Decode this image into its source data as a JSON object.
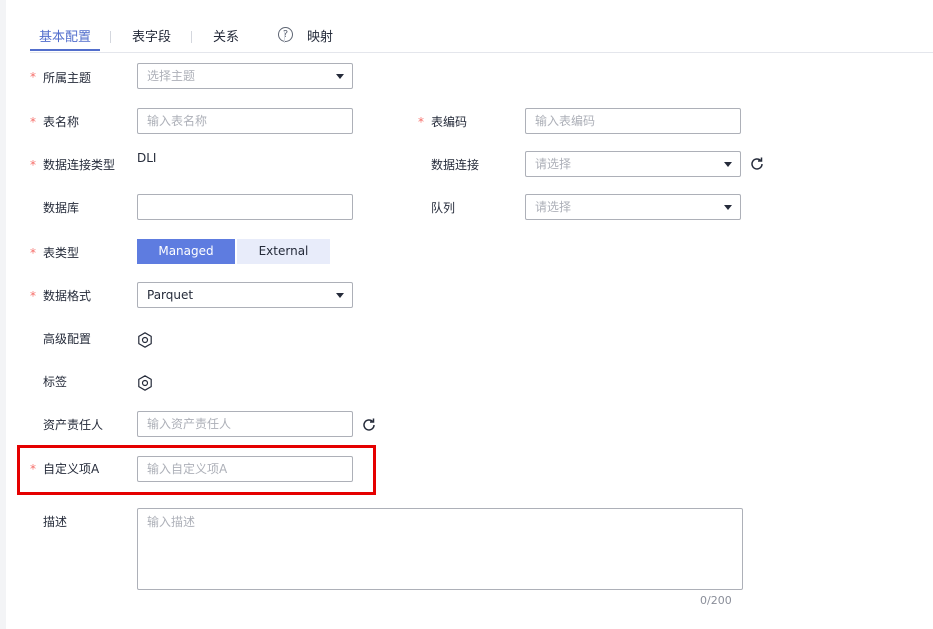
{
  "tabs": [
    {
      "label": "基本配置"
    },
    {
      "label": "表字段"
    },
    {
      "label": "关系"
    },
    {
      "label": "映射"
    }
  ],
  "tab_help_icon": "question-circle-icon",
  "form": {
    "subject": {
      "label": "所属主题",
      "placeholder": "选择主题"
    },
    "table_name": {
      "label": "表名称",
      "placeholder": "输入表名称"
    },
    "table_code": {
      "label": "表编码",
      "placeholder": "输入表编码"
    },
    "conn_type": {
      "label": "数据连接类型",
      "value": "DLI"
    },
    "data_conn": {
      "label": "数据连接",
      "placeholder": "请选择"
    },
    "database": {
      "label": "数据库",
      "value": ""
    },
    "queue": {
      "label": "队列",
      "placeholder": "请选择"
    },
    "table_type": {
      "label": "表类型",
      "options": [
        "Managed",
        "External"
      ],
      "selected": "Managed"
    },
    "data_format": {
      "label": "数据格式",
      "value": "Parquet"
    },
    "advanced": {
      "label": "高级配置",
      "icon": "gear-icon"
    },
    "tags": {
      "label": "标签",
      "icon": "gear-icon"
    },
    "owner": {
      "label": "资产责任人",
      "placeholder": "输入资产责任人"
    },
    "custom_a": {
      "label": "自定义项A",
      "placeholder": "输入自定义项A"
    },
    "description": {
      "label": "描述",
      "placeholder": "输入描述",
      "counter": "0/200"
    }
  },
  "required_mark": "*",
  "colors": {
    "primary": "#5e7ce0",
    "required": "#f66f6a",
    "highlight": "#e50000"
  }
}
